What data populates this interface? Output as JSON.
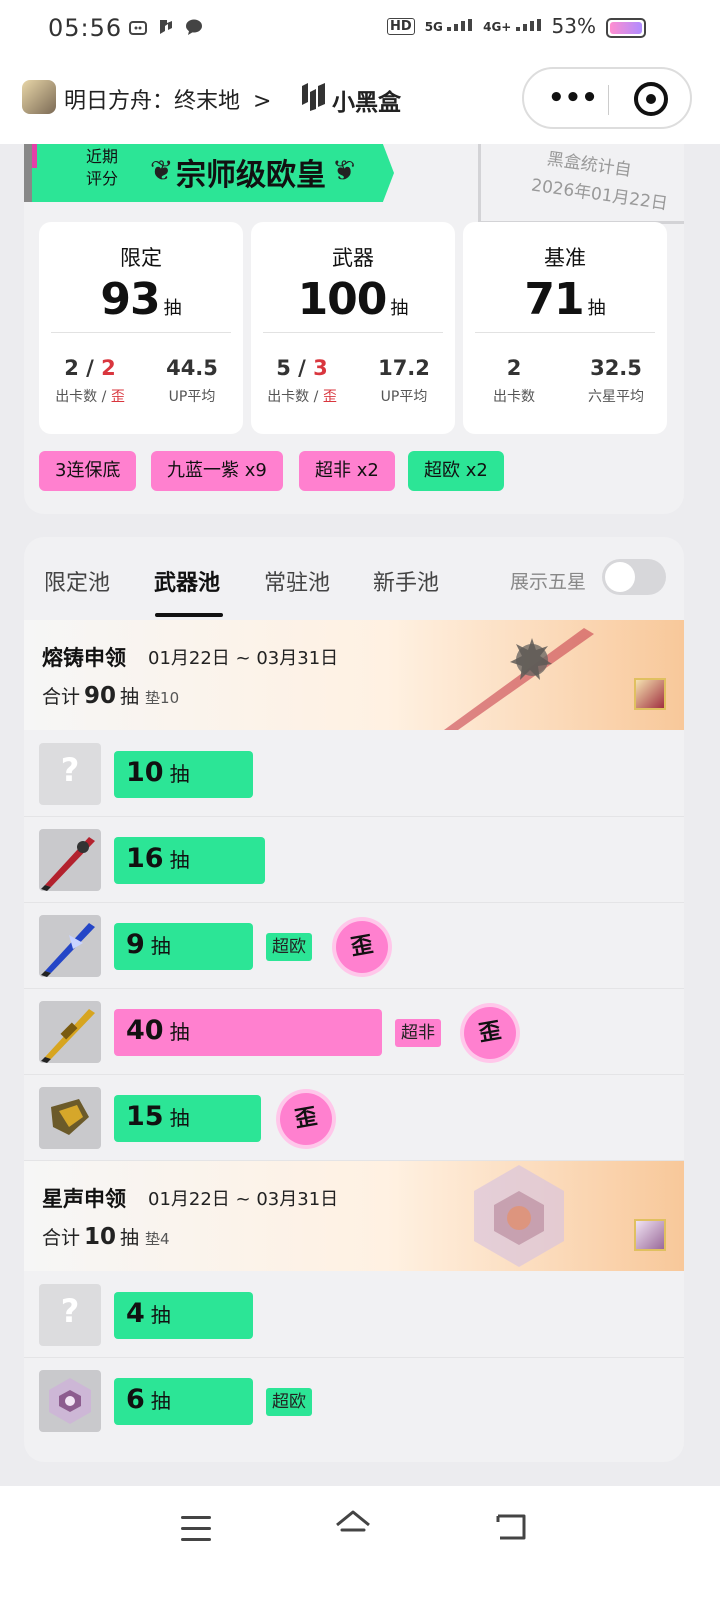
{
  "status": {
    "time": "05:56",
    "network_hd": "HD",
    "network_5g": "5G",
    "network_4g": "4G+",
    "battery": "53%"
  },
  "header": {
    "game_name": "明日方舟：终末地",
    "chevron": ">",
    "logo_text": "小黑盒",
    "more_label": "•••"
  },
  "summary": {
    "rating_label": "近期 评分",
    "rating_value": "宗师级欧皇",
    "stamp_line1": "黑盒统计自",
    "stamp_line2": "2026年01月22日",
    "boxes": [
      {
        "title": "限定",
        "count": "93",
        "unit": "抽",
        "left_value_a": "2",
        "left_slash": " / ",
        "left_value_b": "2",
        "left_label_a": "出卡数 / ",
        "left_label_b": "歪",
        "right_value": "44.5",
        "right_label": "UP平均"
      },
      {
        "title": "武器",
        "count": "100",
        "unit": "抽",
        "left_value_a": "5",
        "left_slash": " / ",
        "left_value_b": "3",
        "left_label_a": "出卡数 / ",
        "left_label_b": "歪",
        "right_value": "17.2",
        "right_label": "UP平均"
      },
      {
        "title": "基准",
        "count": "71",
        "unit": "抽",
        "left_value_a": "2",
        "left_label_a": "出卡数",
        "right_value": "32.5",
        "right_label": "六星平均"
      }
    ],
    "tags": [
      {
        "text": "3连保底",
        "color": "#ff80cf"
      },
      {
        "text": "九蓝一紫 x9",
        "color": "#ff80cf"
      },
      {
        "text": "超非 x2",
        "color": "#ff80cf"
      },
      {
        "text": "超欧 x2",
        "color": "#2ce596"
      }
    ]
  },
  "tabs": {
    "items": [
      "限定池",
      "武器池",
      "常驻池",
      "新手池"
    ],
    "active": "武器池",
    "toggle_label": "展示五星"
  },
  "pools": [
    {
      "name": "熔铸申领",
      "date": "01月22日 ~ 03月31日",
      "total_prefix": "合计",
      "total": "90",
      "total_unit": "抽",
      "pad": "垫10",
      "pulls": [
        {
          "count": "10",
          "unit": "抽",
          "unknown": true,
          "bar_color": "green"
        },
        {
          "count": "16",
          "unit": "抽",
          "bar_color": "green"
        },
        {
          "count": "9",
          "unit": "抽",
          "bar_color": "green",
          "badge": "超欧",
          "badge_color": "green",
          "wai": "歪"
        },
        {
          "count": "40",
          "unit": "抽",
          "bar_color": "pink",
          "badge": "超非",
          "badge_color": "pink",
          "wai": "歪"
        },
        {
          "count": "15",
          "unit": "抽",
          "bar_color": "green",
          "wai": "歪"
        }
      ]
    },
    {
      "name": "星声申领",
      "date": "01月22日 ~ 03月31日",
      "total_prefix": "合计",
      "total": "10",
      "total_unit": "抽",
      "pad": "垫4",
      "pulls": [
        {
          "count": "4",
          "unit": "抽",
          "unknown": true,
          "bar_color": "green"
        },
        {
          "count": "6",
          "unit": "抽",
          "bar_color": "green",
          "badge": "超欧",
          "badge_color": "green"
        }
      ]
    }
  ],
  "colors": {
    "accent_green": "#2ce596",
    "accent_pink": "#ff80cf",
    "wai_red": "#d9363e"
  }
}
